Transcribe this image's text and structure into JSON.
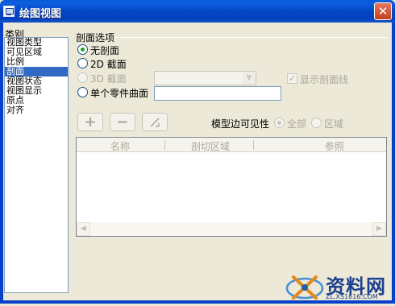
{
  "window": {
    "title": "绘图视图",
    "close_glyph": "✕"
  },
  "categories": {
    "label": "类别",
    "items": [
      {
        "label": "视图类型",
        "selected": false
      },
      {
        "label": "可见区域",
        "selected": false
      },
      {
        "label": "比例",
        "selected": false
      },
      {
        "label": "剖面",
        "selected": true
      },
      {
        "label": "视图状态",
        "selected": false
      },
      {
        "label": "视图显示",
        "selected": false
      },
      {
        "label": "原点",
        "selected": false
      },
      {
        "label": "对齐",
        "selected": false
      }
    ]
  },
  "section_options": {
    "label": "剖面选项",
    "no_section": "无剖面",
    "section_2d": "2D 截面",
    "section_3d": "3D 截面",
    "single_part_surface": "单个零件曲面",
    "show_section_lines": "显示剖面线",
    "selected_option": "无剖面"
  },
  "toolbar": {
    "add_glyph": "+",
    "remove_glyph": "−",
    "edit_glyph": "⁄"
  },
  "model_edge_visibility": {
    "label": "模型边可见性",
    "all": "全部",
    "area": "区域",
    "selected": "全部"
  },
  "table": {
    "columns": [
      "名称",
      "剖切区域",
      "参照"
    ]
  },
  "watermark": {
    "text": "资料网",
    "url_text": "ZL.XS1616.COM"
  },
  "colors": {
    "title_bar": "#0a5ad6",
    "selection": "#316ac5",
    "dialog_bg": "#ece9d8",
    "radio_check": "#21a121"
  }
}
